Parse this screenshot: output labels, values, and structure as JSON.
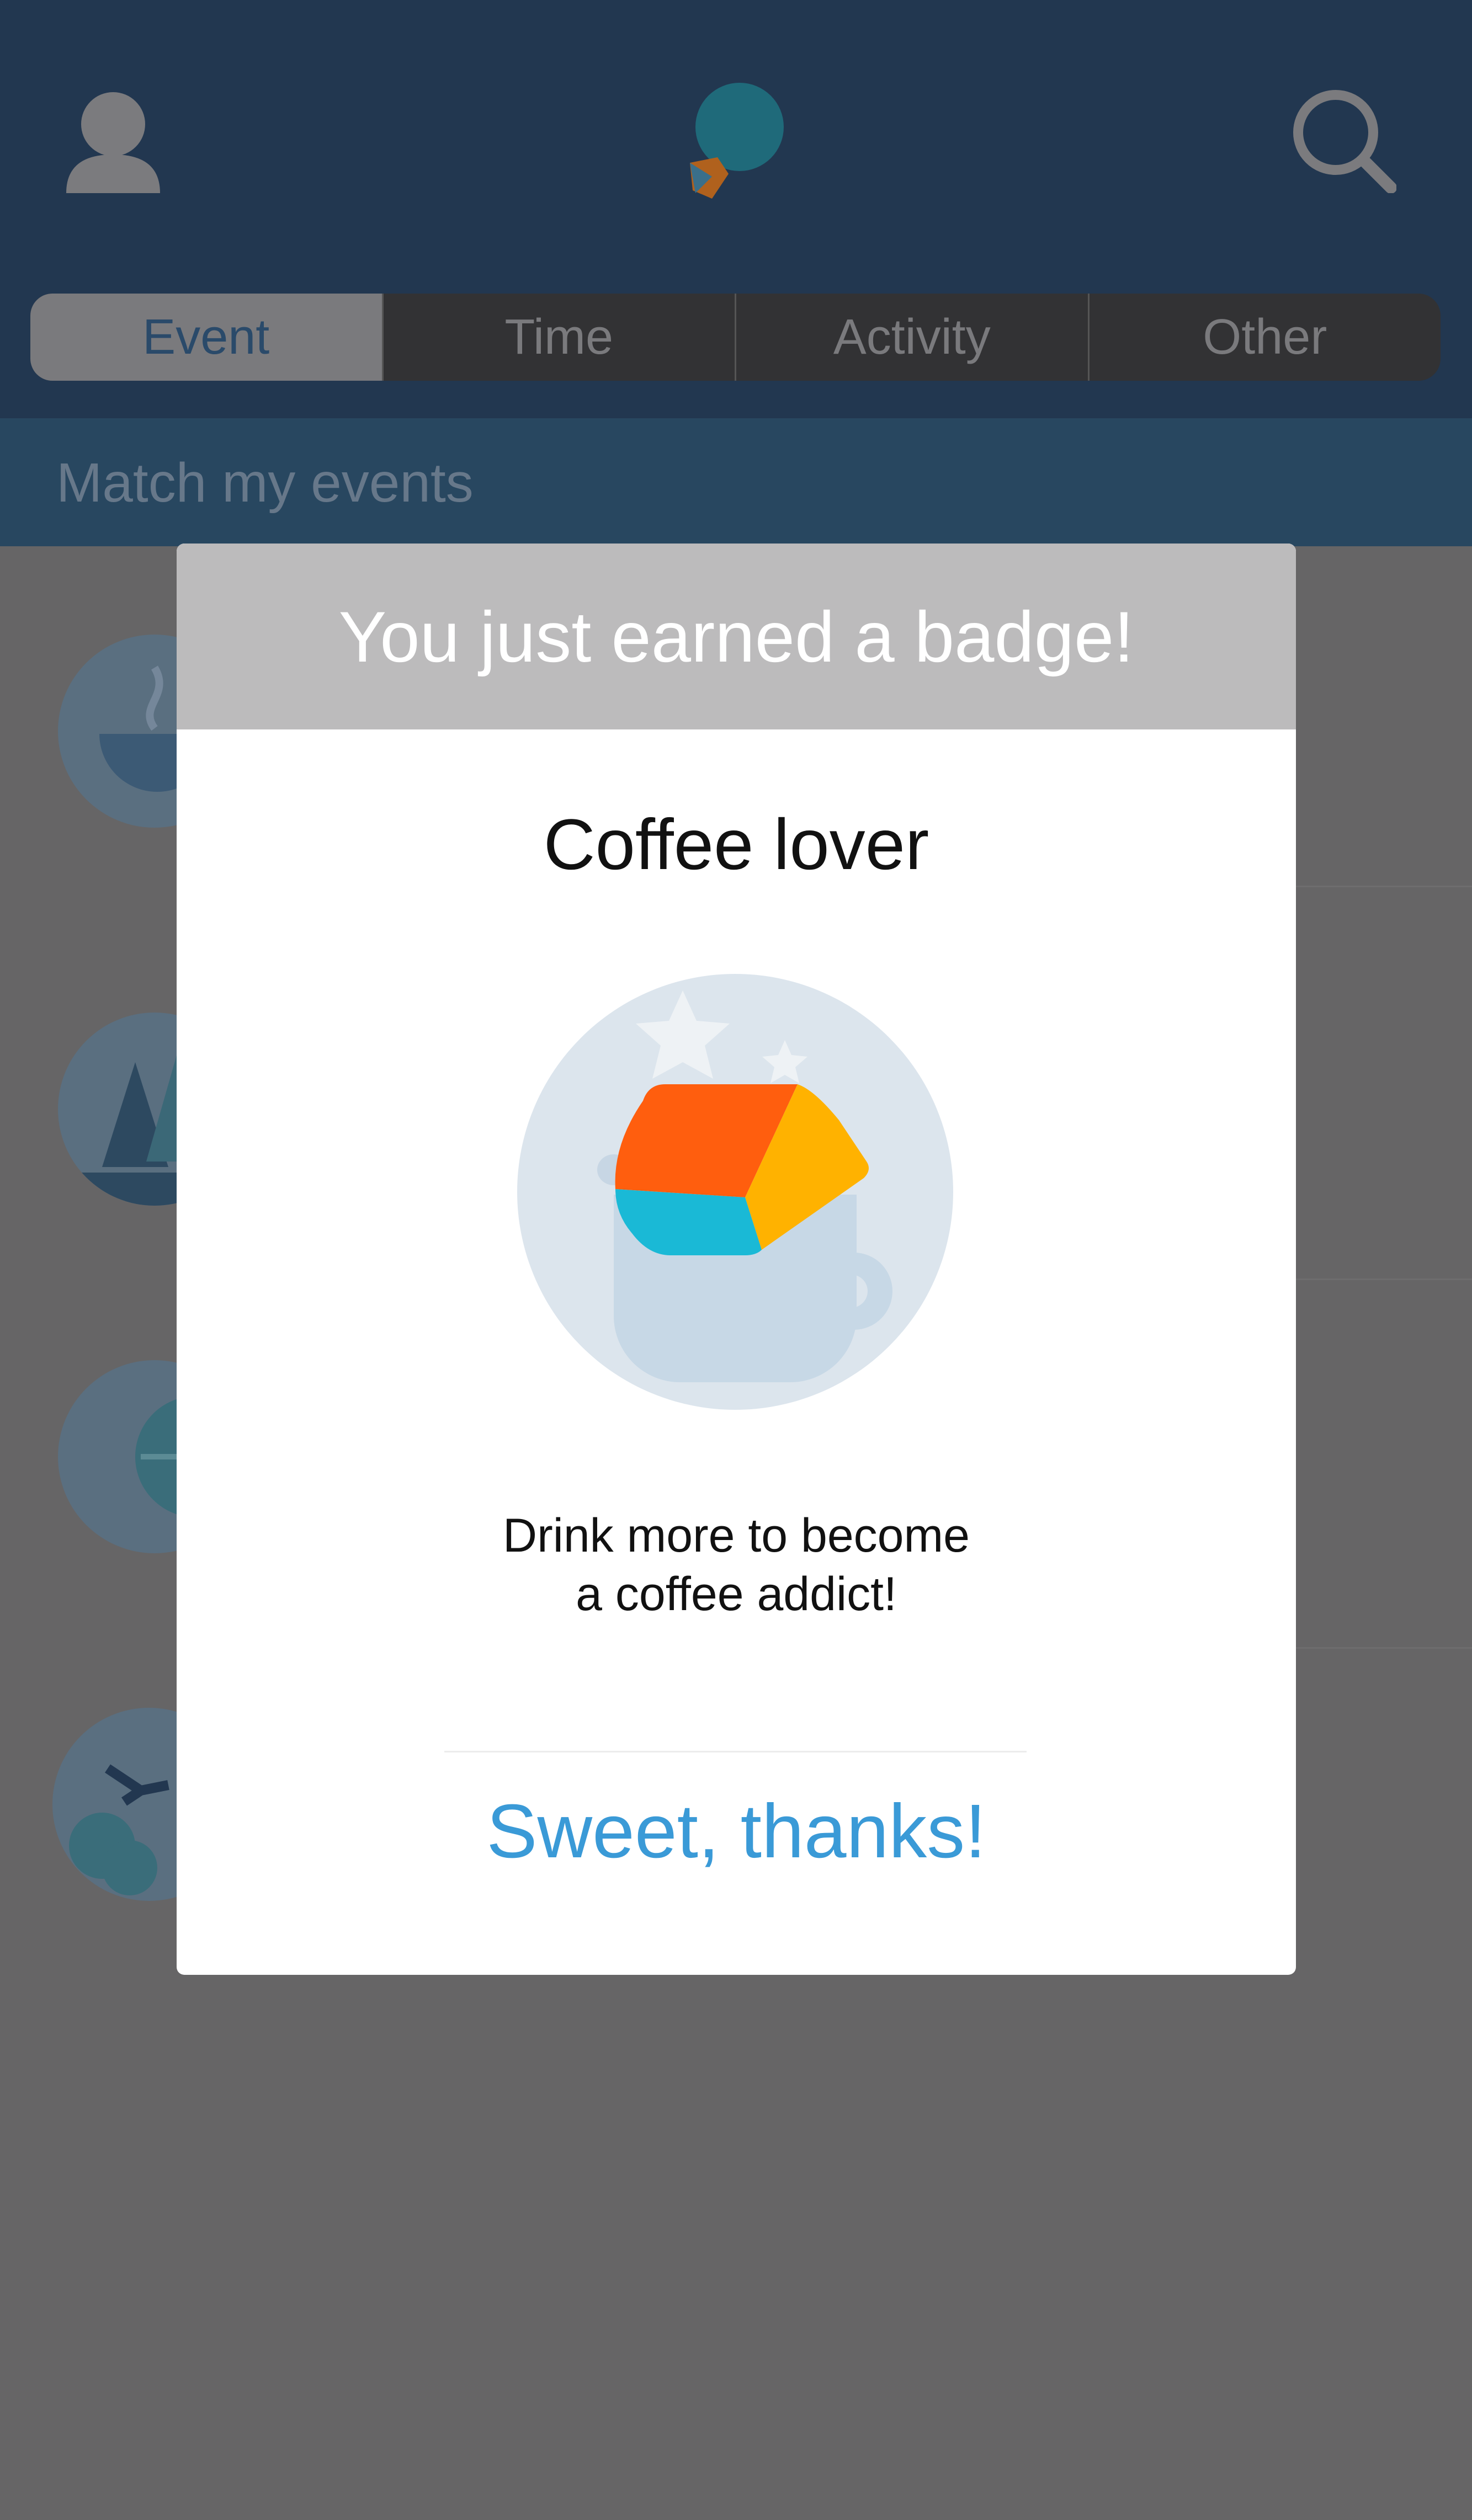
{
  "header": {
    "tabs": [
      "Event",
      "Time",
      "Activity",
      "Other"
    ],
    "active_tab": "Event"
  },
  "subheader": {
    "label": "Match my events"
  },
  "modal": {
    "title": "You just earned a badge!",
    "badge_name": "Coffee lover",
    "description_line1": "Drink more to become",
    "description_line2": "a coffee addict!",
    "confirm_label": "Sweet, thanks!"
  },
  "icons": {
    "profile": "user-icon",
    "logo": "app-logo-icon",
    "search": "search-icon",
    "badge": "coffee-cup-badge-icon"
  },
  "colors": {
    "header_bg": "#223750",
    "accent_blue": "#3a9ad7",
    "modal_header_bg": "#bcbbbc",
    "overlay": "#666566"
  }
}
